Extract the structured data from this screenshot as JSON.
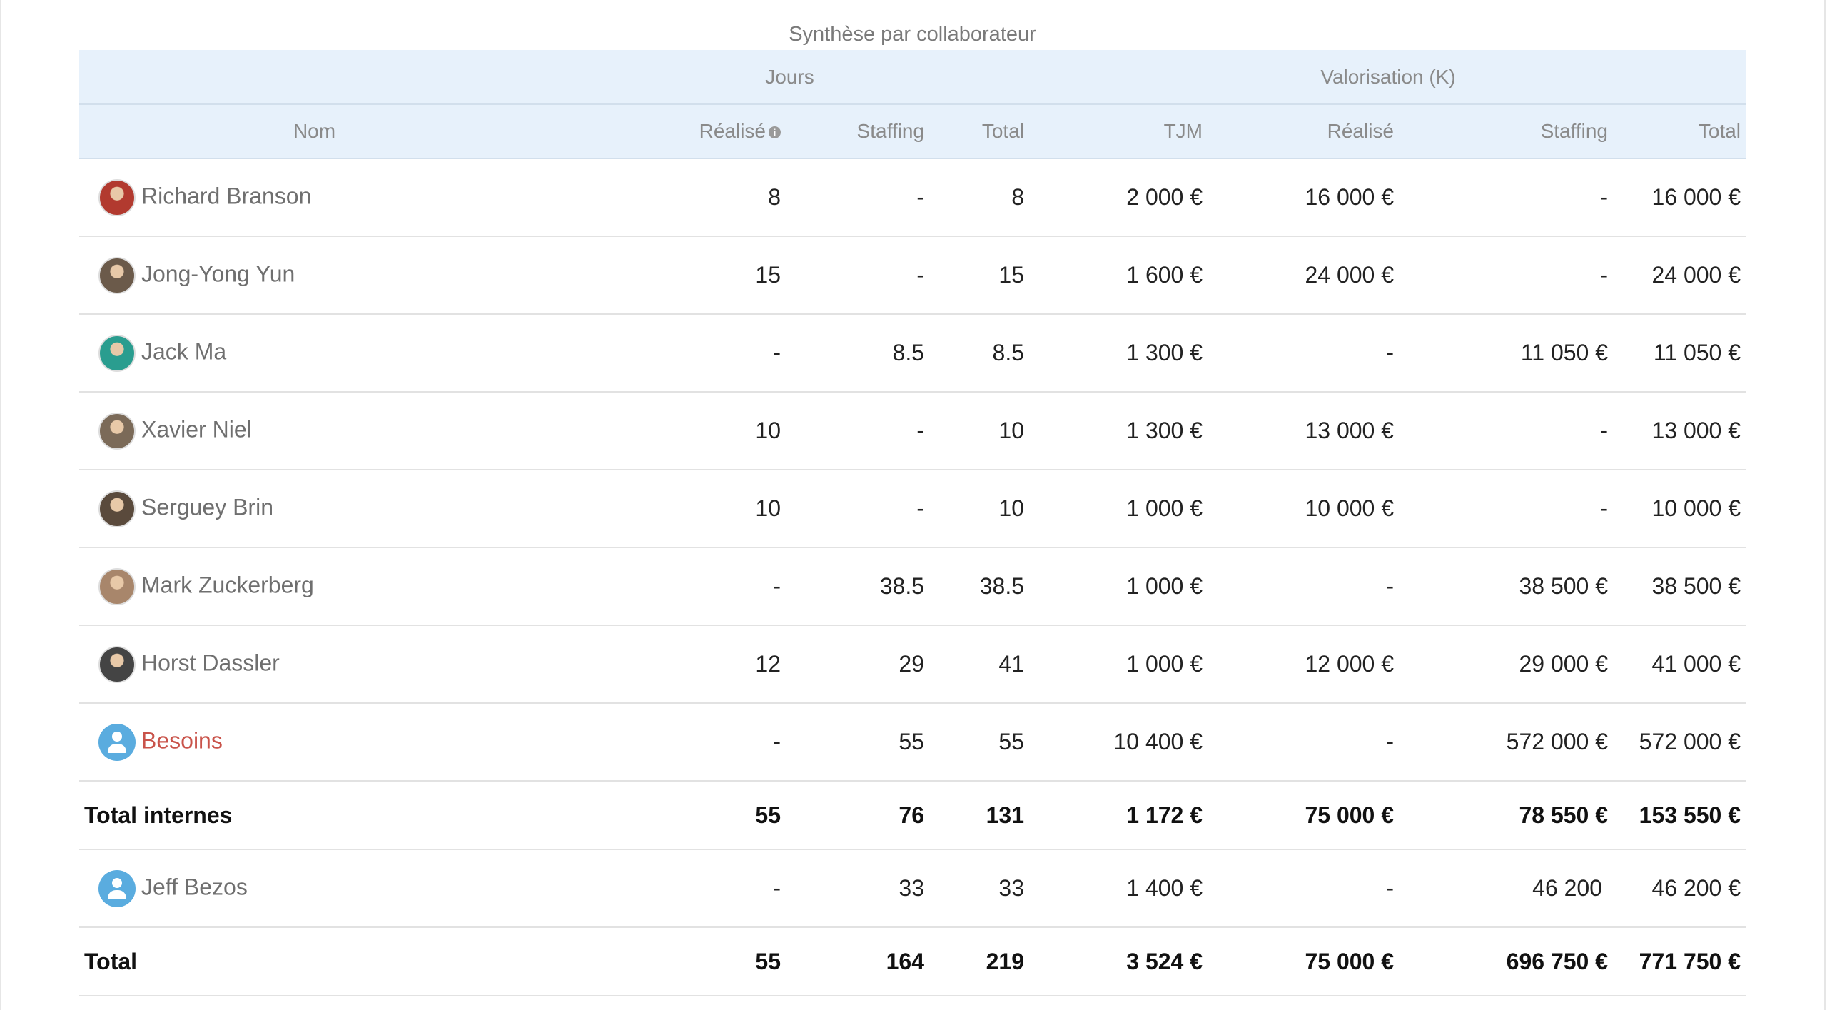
{
  "caption": "Synthèse par collaborateur",
  "groups": {
    "jours": "Jours",
    "valorisation": "Valorisation (K)"
  },
  "headers": {
    "nom": "Nom",
    "realise": "Réalisé",
    "staffing": "Staffing",
    "total": "Total",
    "tjm": "TJM",
    "v_realise": "Réalisé",
    "v_staffing": "Staffing",
    "v_total": "Total"
  },
  "info_icon": "info-icon",
  "rows": [
    {
      "name": "Richard Branson",
      "avatar_color": "#b23a2f",
      "realise": "8",
      "staffing": "-",
      "total": "8",
      "tjm": "2 000 €",
      "v_realise": "16 000 €",
      "v_staffing": "-",
      "v_total": "16 000 €"
    },
    {
      "name": "Jong-Yong Yun",
      "avatar_color": "#6b5a4a",
      "realise": "15",
      "staffing": "-",
      "total": "15",
      "tjm": "1 600 €",
      "v_realise": "24 000 €",
      "v_staffing": "-",
      "v_total": "24 000 €"
    },
    {
      "name": "Jack Ma",
      "avatar_color": "#2a9d8f",
      "realise": "-",
      "staffing": "8.5",
      "total": "8.5",
      "tjm": "1 300 €",
      "v_realise": "-",
      "v_staffing": "11 050 €",
      "v_total": "11 050 €"
    },
    {
      "name": "Xavier Niel",
      "avatar_color": "#7b6a58",
      "realise": "10",
      "staffing": "-",
      "total": "10",
      "tjm": "1 300 €",
      "v_realise": "13 000 €",
      "v_staffing": "-",
      "v_total": "13 000 €"
    },
    {
      "name": "Serguey Brin",
      "avatar_color": "#5a4a3c",
      "realise": "10",
      "staffing": "-",
      "total": "10",
      "tjm": "1 000 €",
      "v_realise": "10 000 €",
      "v_staffing": "-",
      "v_total": "10 000 €"
    },
    {
      "name": "Mark Zuckerberg",
      "avatar_color": "#a8866b",
      "realise": "-",
      "staffing": "38.5",
      "total": "38.5",
      "tjm": "1 000 €",
      "v_realise": "-",
      "v_staffing": "38 500 €",
      "v_total": "38 500 €"
    },
    {
      "name": "Horst Dassler",
      "avatar_color": "#444444",
      "realise": "12",
      "staffing": "29",
      "total": "41",
      "tjm": "1 000 €",
      "v_realise": "12 000 €",
      "v_staffing": "29 000 €",
      "v_total": "41 000 €"
    },
    {
      "name": "Besoins",
      "avatar_color": "#5aacdf",
      "realise": "-",
      "staffing": "55",
      "total": "55",
      "tjm": "10 400 €",
      "v_realise": "-",
      "v_staffing": "572 000 €",
      "v_total": "572 000 €"
    }
  ],
  "total_internes": {
    "label": "Total internes",
    "realise": "55",
    "staffing": "76",
    "total": "131",
    "tjm": "1 172 €",
    "v_realise": "75 000 €",
    "v_staffing": "78 550 €",
    "v_total": "153 550 €"
  },
  "external": {
    "name": "Jeff Bezos",
    "realise": "-",
    "staffing": "33",
    "total": "33",
    "tjm": "1 400 €",
    "v_realise": "-",
    "v_staffing": "46 200",
    "v_total": "46 200 €"
  },
  "total": {
    "label": "Total",
    "realise": "55",
    "staffing": "164",
    "total": "219",
    "tjm": "3 524 €",
    "v_realise": "75 000 €",
    "v_staffing": "696 750 €",
    "v_total": "771 750 €"
  }
}
